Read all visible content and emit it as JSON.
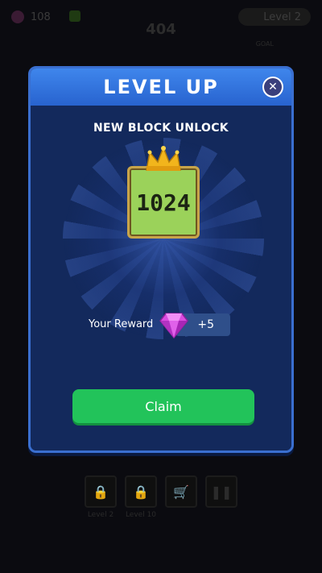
{
  "background": {
    "gem_count": "108",
    "level_label": "Level 2",
    "score": "404",
    "goal_label": "GOAL",
    "bottom_buttons": [
      {
        "icon": "lock-icon",
        "label": "Level 2"
      },
      {
        "icon": "lock-icon",
        "label": "Level 10"
      },
      {
        "icon": "cart-icon",
        "label": ""
      },
      {
        "icon": "pause-icon",
        "label": ""
      }
    ]
  },
  "modal": {
    "title": "LEVEL UP",
    "close_icon": "close-icon",
    "subtitle": "NEW BLOCK UNLOCK",
    "block_value": "1024",
    "reward_label": "Your Reward",
    "reward_amount": "+5",
    "reward_icon": "gem-icon",
    "claim_label": "Claim"
  },
  "colors": {
    "header": "#3f86ec",
    "body": "#13295c",
    "block": "#9bd25a",
    "claim": "#22c35a",
    "gem": "#d94ce0"
  }
}
